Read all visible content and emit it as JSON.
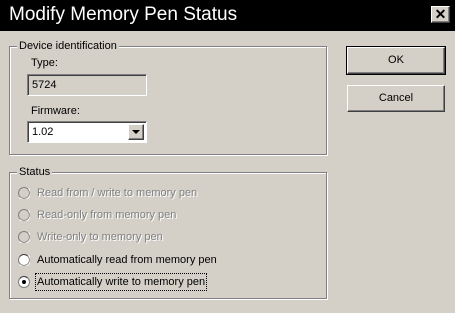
{
  "window": {
    "title": "Modify Memory Pen Status",
    "close_glyph": "✕"
  },
  "device_identification": {
    "group_title": "Device identification",
    "type_label": "Type:",
    "type_value": "5724",
    "firmware_label": "Firmware:",
    "firmware_selected": "1.02"
  },
  "buttons": {
    "ok": "OK",
    "cancel": "Cancel"
  },
  "status": {
    "group_title": "Status",
    "options": [
      {
        "label": "Read from / write to memory pen",
        "enabled": false,
        "checked": false
      },
      {
        "label": "Read-only from memory pen",
        "enabled": false,
        "checked": false
      },
      {
        "label": "Write-only to memory pen",
        "enabled": false,
        "checked": false
      },
      {
        "label": "Automatically read from memory pen",
        "enabled": true,
        "checked": false
      },
      {
        "label": "Automatically write to memory pen",
        "enabled": true,
        "checked": true
      }
    ]
  },
  "icons": {
    "dropdown": "chevron-down-icon",
    "close": "close-icon"
  }
}
